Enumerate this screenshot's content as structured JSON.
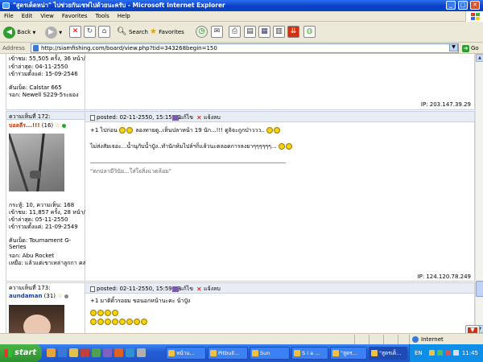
{
  "window": {
    "title": "\"สูตรเด็ดหน่า\" ไปช่วยกันเซฟไปด้วยนะครับ - Microsoft Internet Explorer"
  },
  "menu": [
    "File",
    "Edit",
    "View",
    "Favorites",
    "Tools",
    "Help"
  ],
  "toolbar": {
    "back": "Back",
    "search": "Search",
    "favorites": "Favorites"
  },
  "address": {
    "label": "Address",
    "url": "http://siamfishing.com/board/view.php?tid=343268begin=150",
    "go": "Go"
  },
  "posts": {
    "top": {
      "views": "เข้าชม: 55,505 ครั้ง, 36 หน้า/วัน",
      "last": "เข้าล่าสุด: 04-11-2550",
      "joined": "เข้าร่วมตั้งแต่: 15-09-2546",
      "rod": "คันเบ็ด: Calstar 665",
      "reel": "รอก: Newell S229-5ระยอง",
      "ip": "IP: 203.147.39.29"
    },
    "p172": {
      "num": "ความเห็นที่ 172:",
      "user": "บอลลีร...!!!",
      "level": "(16)",
      "posted": "posted: 02-11-2550, 15:15:42",
      "edit": "แก้ไข",
      "report": "แจ้งลบ",
      "line1": "+1 ไปก่อน",
      "line1b": "ลองทายดู..เห็นปลาหน้า 19 นัก...!!! ดูจิจะถูกป่าววว..",
      "line2": "ไม่ส่งสัยเจอะ...น้ำนุกับน้ำปู๋ง..ทำนักห์มไปล์ฯก็แล้วนะตลอดการลงยาๆๆๆๆๆๆ...",
      "sig": "\"ตกปลามีวินัย...ใส่ใจสิ่งแวดล้อม\"",
      "stats": "กระทู้: 10, ความเห็น: 168",
      "views": "เข้าชม: 11,857 ครั้ง, 28 หน้า/วัน",
      "last": "เข้าล่าสุด: 05-11-2550",
      "joined": "เข้าร่วมตั้งแต่: 21-09-2549",
      "rod": "คันเบ็ด: Tournament G-Series",
      "reel": "รอก: Abu Rocket",
      "lure": "เหยื่อ: แล้วแต่เขาเหล่าลูกกา คลอง 7",
      "ip": "IP: 124.120.78.249"
    },
    "p173": {
      "num": "ความเห็นที่ 173:",
      "user": "aundaman",
      "level": "(31)",
      "posted": "posted: 02-11-2550, 15:59:03",
      "edit": "แก้ไข",
      "report": "แจ้งลบ",
      "line1": "+1 มาติดิ้วรอยม ขอนอกหน้านะคะ น้าปู๋ง"
    }
  },
  "status": {
    "zone": "Internet"
  },
  "taskbar": {
    "start": "start",
    "tasks": [
      "หน้าแ...",
      "Pitbull...",
      "Sun",
      "S i a ...",
      "\"สูตร...",
      "\"สูตรเด็..."
    ],
    "lang": "EN",
    "clock": "11:45"
  },
  "colors": {
    "accent": "#0a3fc7",
    "username": "#c03000",
    "username2": "#1a3fa0",
    "online": "#22aa22",
    "offline": "#888888"
  }
}
